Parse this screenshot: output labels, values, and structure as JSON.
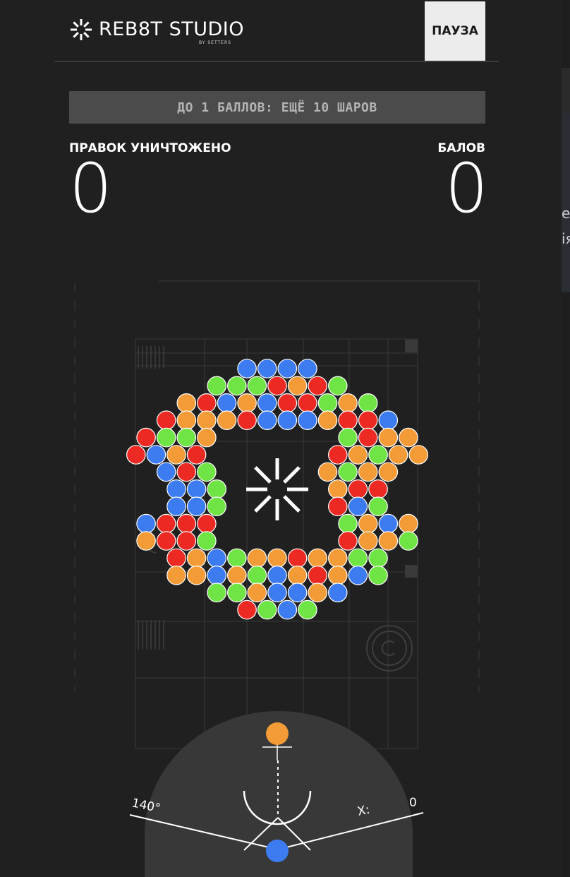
{
  "header": {
    "brand": "REB8T STUDIO",
    "brand_sub": "BY SETTERS",
    "pause_label": "ПАУЗА"
  },
  "goal_banner": "ДО 1 БАЛЛОВ: ЕЩЁ 10 ШАРОВ",
  "stats": {
    "destroyed_label": "ПРАВОК УНИЧТОЖЕНО",
    "destroyed_value": "0",
    "score_label": "БАЛОВ",
    "score_value": "0"
  },
  "aim": {
    "angle_label": "140°",
    "x_label": "X:",
    "x_value": "0"
  },
  "colors": {
    "blue": "#3d7cf0",
    "green": "#6fe445",
    "red": "#ec2a23",
    "orange": "#f29b37",
    "background": "#202020",
    "banner": "#4b4b4b"
  },
  "current_ball": "blue",
  "next_ball": "orange",
  "bubble_rows": [
    "BBBB",
    "GGGRORG",
    "ORBOBRRGOG",
    "ROOORBBBORRB",
    "RGGO GROO",
    "RBOR ROGOO",
    "BRG OGOO",
    "BBG ORR",
    "BBG RBG",
    "BRRR GOBO",
    "ORRG ROOG",
    "ROBGOOROOGG",
    "OOBOGBOROBG",
    "GGOBBOB",
    "RGBG"
  ],
  "side_fragments": [
    "е",
    "ія"
  ]
}
